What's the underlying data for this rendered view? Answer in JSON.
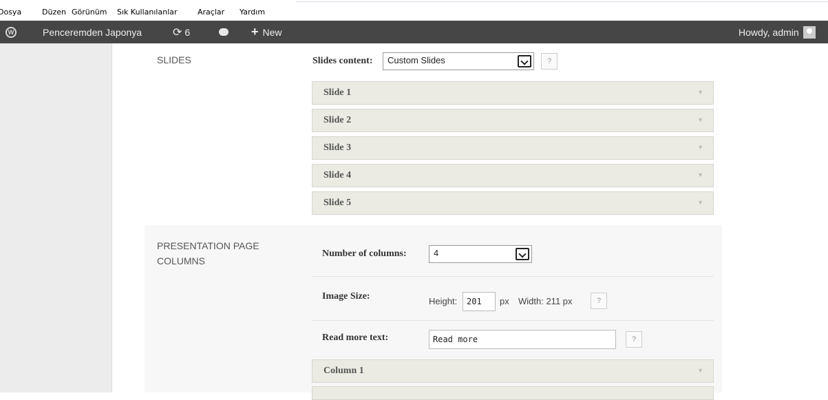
{
  "menu": [
    "Dosya",
    "Düzen",
    "Görünüm",
    "Sık Kullanılanlar",
    "Araçlar",
    "Yardım"
  ],
  "adminbar": {
    "site_name": "Penceremden Japonya",
    "updates_count": "6",
    "new_label": "New",
    "greeting": "Howdy, admin"
  },
  "slides_section": {
    "heading": "SLIDES",
    "content_label": "Slides content:",
    "content_value": "Custom Slides",
    "help": "?",
    "slides": [
      "Slide 1",
      "Slide 2",
      "Slide 3",
      "Slide 4",
      "Slide 5"
    ]
  },
  "presentation_section": {
    "heading_line1": "PRESENTATION PAGE",
    "heading_line2": "COLUMNS",
    "columns_label": "Number of columns:",
    "columns_value": "4",
    "image_size_label": "Image Size:",
    "height_label": "Height:",
    "height_value": "201",
    "height_unit": "px",
    "width_text": "Width: 211 px",
    "help": "?",
    "read_more_label": "Read more text:",
    "read_more_value": "Read more",
    "columns": [
      "Column 1"
    ]
  },
  "colors": {
    "adminbar_bg": "#464646",
    "slide_bg": "#ebebe4"
  },
  "icons": [
    "wordpress-logo-icon",
    "refresh-icon",
    "comment-icon",
    "plus-icon",
    "avatar-icon",
    "chevron-down-icon"
  ]
}
